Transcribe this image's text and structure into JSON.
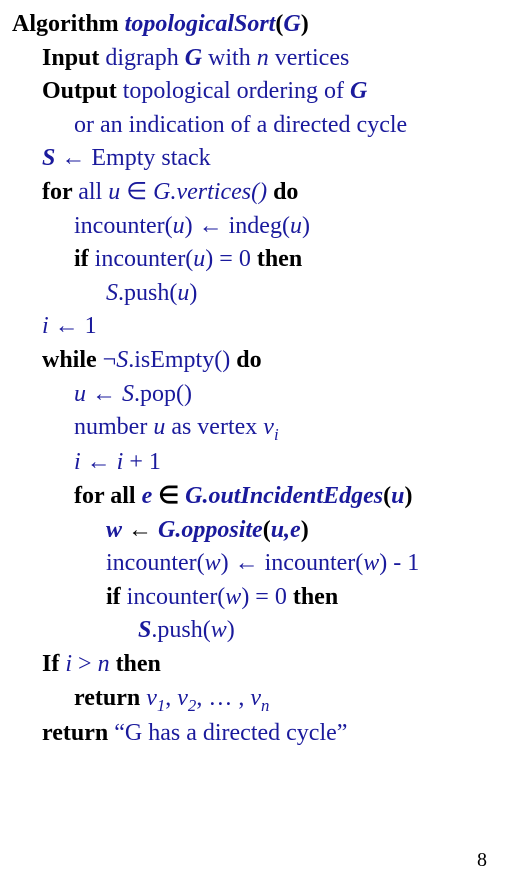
{
  "l1": {
    "kw": "Algorithm ",
    "name": "topologicalSort",
    "open": "(",
    "arg": "G",
    "close": ")"
  },
  "l2": {
    "kw": "Input ",
    "t1": "digraph ",
    "g": "G",
    "t2": " with ",
    "n": "n",
    "t3": " vertices"
  },
  "l3": {
    "kw": "Output ",
    "t": "topological ordering of ",
    "g": "G"
  },
  "l4": {
    "t": "or an indication of a directed cycle"
  },
  "l5": {
    "s": "S",
    "arr": " ← ",
    "t": "Empty stack"
  },
  "l6": {
    "kw1": "for ",
    "t1": "all ",
    "u": "u",
    "in": " ∈ ",
    "gv": "G.vertices()",
    "kw2": " do"
  },
  "l7": {
    "t1": "incounter(",
    "u1": "u",
    "t2": ") ← indeg(",
    "u2": "u",
    "t3": ")"
  },
  "l8": {
    "kw1": "if ",
    "t1": "incounter(",
    "u": "u",
    "t2": ") = 0 ",
    "kw2": "then"
  },
  "l9": {
    "s": "S",
    "t1": ".push(",
    "u": "u",
    "t2": ")"
  },
  "l10": {
    "i": "i",
    "t": " ← 1"
  },
  "l11": {
    "kw1": "while ",
    "neg": "¬",
    "s": "S",
    "t": ".isEmpty() ",
    "kw2": "do"
  },
  "l12": {
    "u": "u",
    "arr": " ← ",
    "s": "S",
    "t": ".pop()"
  },
  "l13": {
    "t1": "number ",
    "u": "u",
    "t2": " as vertex ",
    "v": "v",
    "sub": "i"
  },
  "l14": {
    "i1": "i",
    "arr": " ← ",
    "i2": "i",
    "t": " + 1"
  },
  "l15": {
    "kw": "for ",
    "t1": "all  ",
    "e": "e",
    "in": " ∈ ",
    "goi": "G.outIncidentEdges",
    "open": "(",
    "u": "u",
    "close": ")"
  },
  "l16": {
    "w": "w",
    "arr": " ← ",
    "gop": "G.opposite",
    "open": "(",
    "args": "u,e",
    "close": ")"
  },
  "l17": {
    "t1": "incounter(",
    "w1": "w",
    "t2": ") ← incounter(",
    "w2": "w",
    "t3": ") - 1"
  },
  "l18": {
    "kw1": "if ",
    "t1": "incounter(",
    "w": "w",
    "t2": ") = 0 ",
    "kw2": "then"
  },
  "l19": {
    "s": "S",
    "t1": ".push(",
    "w": "w",
    "t2": ")"
  },
  "l20": {
    "kw1": "If ",
    "i": "i",
    "gt": " > ",
    "n": "n",
    "kw2": " then"
  },
  "l21": {
    "kw": "return ",
    "v1": "v",
    "s1": "1",
    "c1": ", ",
    "v2": "v",
    "s2": "2",
    "c2": ", … , ",
    "v3": "v",
    "s3": "n"
  },
  "l22": {
    "kw": "return ",
    "t": "“G has a directed cycle”"
  },
  "pagenum": "8"
}
